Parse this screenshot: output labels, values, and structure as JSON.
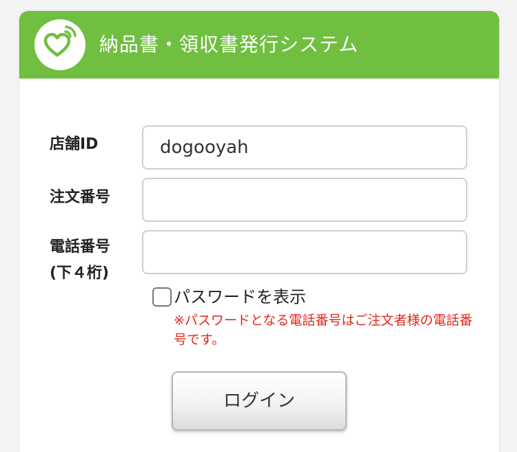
{
  "header": {
    "title": "納品書・領収書発行システム",
    "logo_icon": "heart-signal-icon",
    "brand_color": "#70bf41"
  },
  "form": {
    "store_id": {
      "label": "店舗ID",
      "value": "dogooyah"
    },
    "order_number": {
      "label": "注文番号",
      "value": ""
    },
    "phone_last4": {
      "label_line1": "電話番号",
      "label_line2": "(下４桁)",
      "value": ""
    },
    "show_password": {
      "label": "パスワードを表示",
      "checked": false
    },
    "note": "※パスワードとなる電話番号はご注文者様の電話番号です。",
    "note_color": "#e1271b",
    "login_label": "ログイン"
  }
}
